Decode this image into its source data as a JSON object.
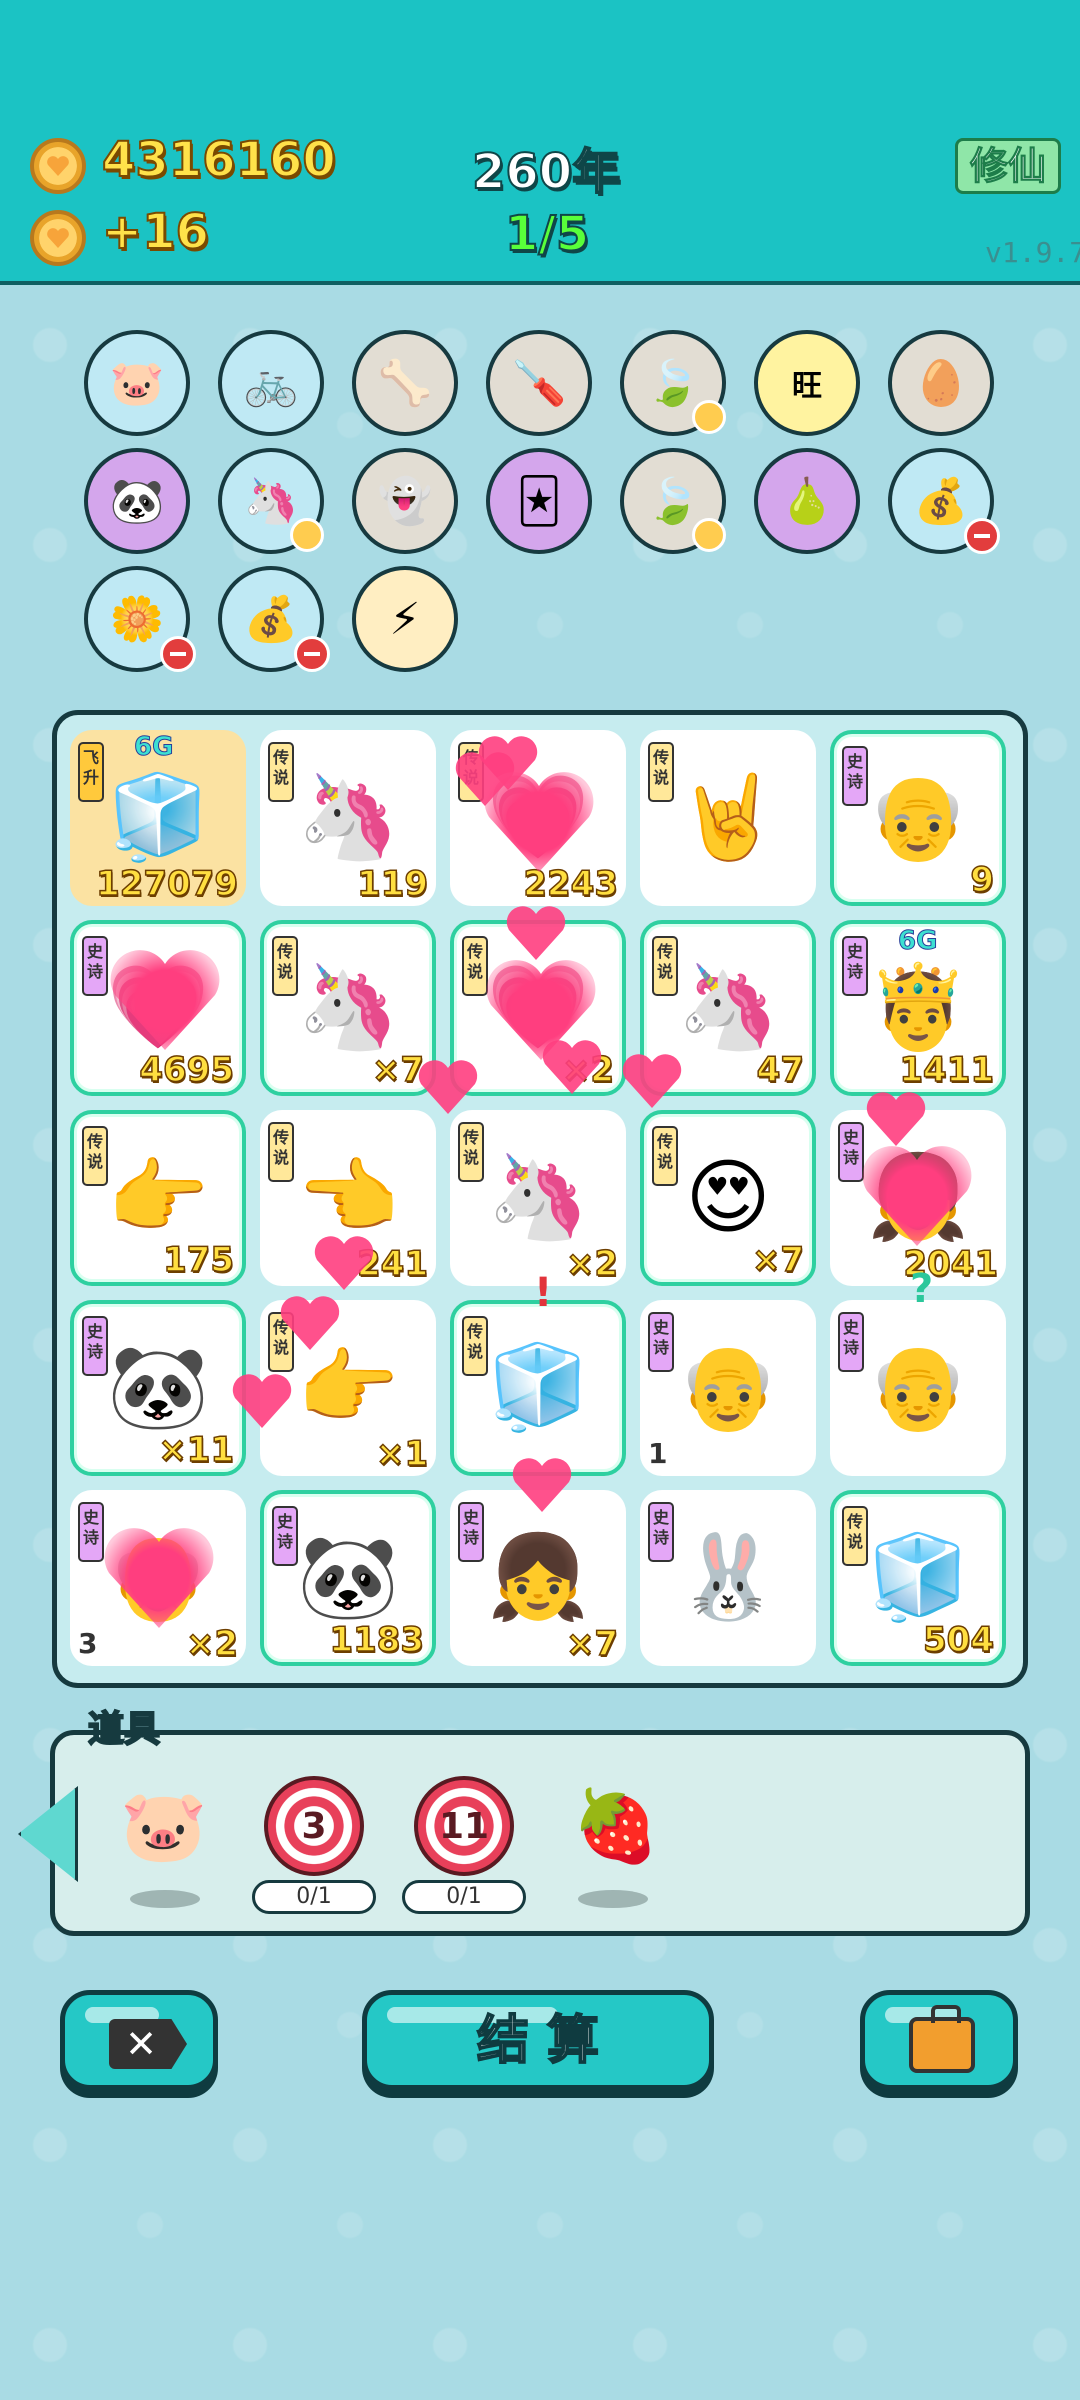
{
  "header": {
    "coins": "4316160",
    "income": "+16",
    "year": "260年",
    "progress": "1/5",
    "xiuxian_label": "修仙",
    "version": "v1.9.7"
  },
  "items": [
    {
      "icon": "piggy-bank-icon",
      "glyph": "🐷"
    },
    {
      "icon": "air-pump-icon",
      "glyph": "🚲"
    },
    {
      "icon": "dog-bowl-icon",
      "glyph": "🦴"
    },
    {
      "icon": "screwdriver-icon",
      "glyph": "🪛"
    },
    {
      "icon": "leaf-icon",
      "glyph": "🍃"
    },
    {
      "icon": "wang-pattern-icon",
      "glyph": "旺"
    },
    {
      "icon": "egg-carton-icon",
      "glyph": "🥚"
    },
    {
      "icon": "panda-icon",
      "glyph": "🐼"
    },
    {
      "icon": "twin-unicorn-icon",
      "glyph": "🦄"
    },
    {
      "icon": "ghost-icon",
      "glyph": "👻"
    },
    {
      "icon": "ghost-card-icon",
      "glyph": "🃏"
    },
    {
      "icon": "leaf-icon-2",
      "glyph": "🍃"
    },
    {
      "icon": "pear-basket-icon",
      "glyph": "🍐"
    },
    {
      "icon": "sack-icon",
      "glyph": "💰"
    },
    {
      "icon": "flower-pot-icon",
      "glyph": "🌼"
    },
    {
      "icon": "sack-icon-2",
      "glyph": "💰"
    },
    {
      "icon": "lightning-icon",
      "glyph": "⚡"
    }
  ],
  "board": [
    {
      "tag": "飞升",
      "tag_type": "fly",
      "glyph": "🧊",
      "count": "127079",
      "badge": "6G",
      "style": "gold"
    },
    {
      "tag": "传说",
      "tag_type": "leg",
      "glyph": "🦄",
      "count": "119"
    },
    {
      "tag": "传说",
      "tag_type": "leg",
      "glyph": "💗",
      "count": "2243"
    },
    {
      "tag": "传说",
      "tag_type": "leg",
      "glyph": "🤘",
      "count": ""
    },
    {
      "tag": "史诗",
      "tag_type": "epic",
      "glyph": "👴",
      "count": "9",
      "style": "border"
    },
    {
      "tag": "史诗",
      "tag_type": "epic",
      "glyph": "💗",
      "count": "4695",
      "style": "border"
    },
    {
      "tag": "传说",
      "tag_type": "leg",
      "glyph": "🦄",
      "count": "×7",
      "style": "border"
    },
    {
      "tag": "传说",
      "tag_type": "leg",
      "glyph": "💗",
      "count": "×2",
      "style": "border"
    },
    {
      "tag": "传说",
      "tag_type": "leg",
      "glyph": "🦄",
      "count": "47",
      "style": "border"
    },
    {
      "tag": "史诗",
      "tag_type": "epic",
      "glyph": "🤴",
      "count": "1411",
      "badge": "6G",
      "style": "border"
    },
    {
      "tag": "传说",
      "tag_type": "leg",
      "glyph": "👉",
      "count": "175",
      "style": "border"
    },
    {
      "tag": "传说",
      "tag_type": "leg",
      "glyph": "👈",
      "count": "241"
    },
    {
      "tag": "传说",
      "tag_type": "leg",
      "glyph": "🦄",
      "count": "×2"
    },
    {
      "tag": "传说",
      "tag_type": "leg",
      "glyph": "😍",
      "count": "×7",
      "style": "border"
    },
    {
      "tag": "史诗",
      "tag_type": "epic",
      "glyph": "👧",
      "count": "2041"
    },
    {
      "tag": "史诗",
      "tag_type": "epic",
      "glyph": "🐼",
      "count": "×11",
      "style": "border"
    },
    {
      "tag": "传说",
      "tag_type": "leg",
      "glyph": "👉",
      "count": "×1"
    },
    {
      "tag": "传说",
      "tag_type": "leg",
      "glyph": "🧊",
      "count": "",
      "style": "border",
      "mark": "!"
    },
    {
      "tag": "史诗",
      "tag_type": "epic",
      "glyph": "👴",
      "count": "",
      "left": "1"
    },
    {
      "tag": "史诗",
      "tag_type": "epic",
      "glyph": "👴",
      "count": "",
      "mark": "?"
    },
    {
      "tag": "史诗",
      "tag_type": "epic",
      "glyph": "👴",
      "count": "×2",
      "left": "3"
    },
    {
      "tag": "史诗",
      "tag_type": "epic",
      "glyph": "🐼",
      "count": "1183",
      "style": "border"
    },
    {
      "tag": "史诗",
      "tag_type": "epic",
      "glyph": "👧",
      "count": "×7"
    },
    {
      "tag": "史诗",
      "tag_type": "epic",
      "glyph": "🐰",
      "count": ""
    },
    {
      "tag": "传说",
      "tag_type": "leg",
      "glyph": "🧊",
      "count": "504",
      "style": "border"
    }
  ],
  "props": {
    "title": "道具",
    "target1": "3",
    "target1_limit": "0/1",
    "target2": "11",
    "target2_limit": "0/1"
  },
  "buttons": {
    "close_icon": "✕",
    "settle_label": "结 算"
  }
}
